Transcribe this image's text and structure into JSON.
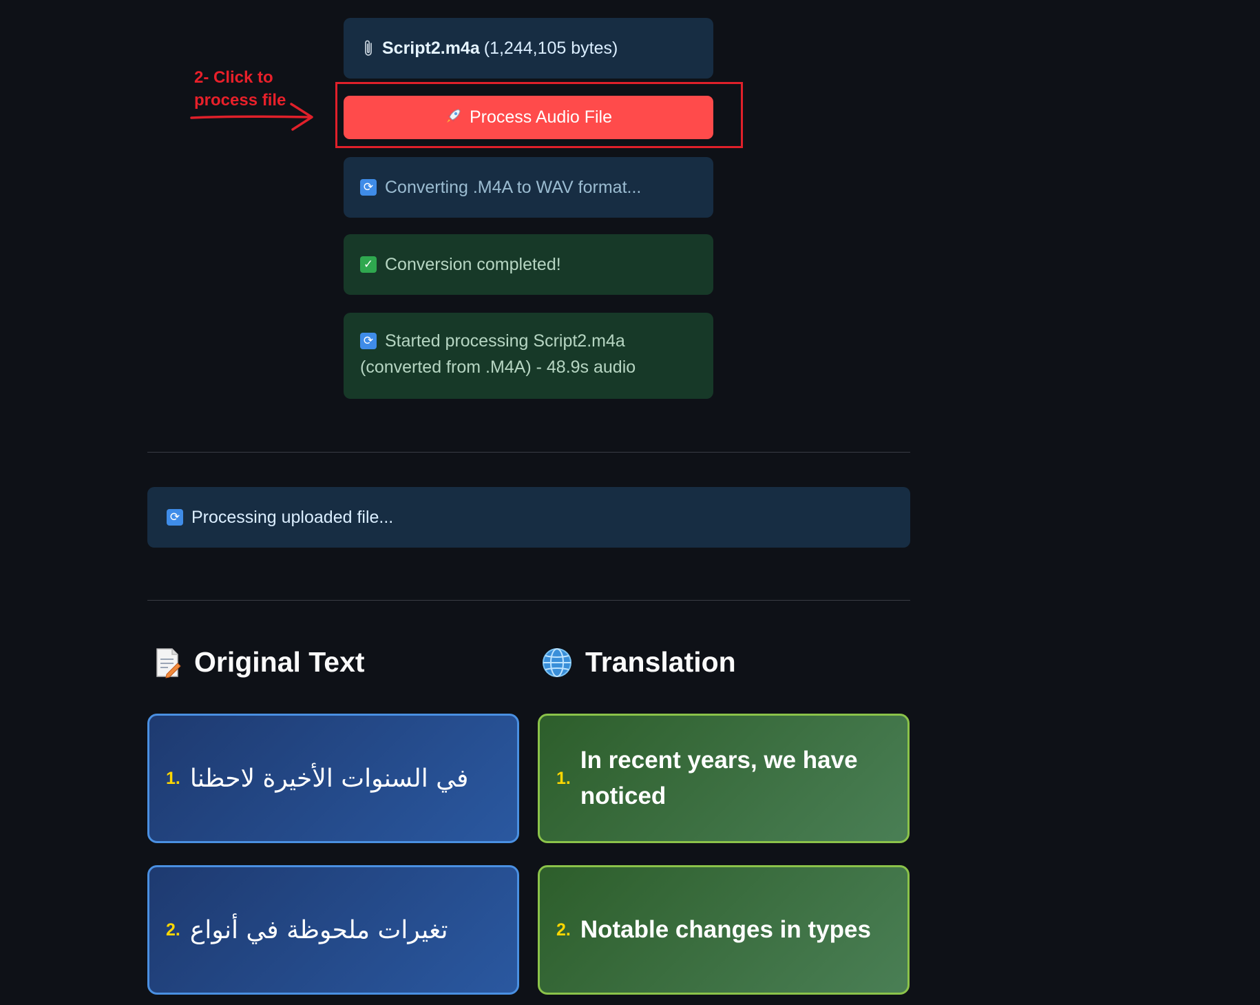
{
  "file": {
    "icon": "paperclip-icon",
    "name": "Script2.m4a",
    "size": "(1,244,105 bytes)"
  },
  "annotation": {
    "text": "2- Click to process file",
    "color": "#e0202a"
  },
  "process_button": {
    "icon": "rocket-icon",
    "label": "Process Audio File",
    "color": "#ff4b4b"
  },
  "status": {
    "converting": "Converting .M4A to WAV format...",
    "completed": "Conversion completed!",
    "started": "Started processing Script2.m4a (converted from .M4A) - 48.9s audio",
    "processing": "Processing uploaded file..."
  },
  "headings": {
    "original": "Original Text",
    "original_icon": "memo-icon",
    "translation": "Translation",
    "translation_icon": "globe-icon"
  },
  "segments": [
    {
      "num": "1.",
      "original": "في السنوات الأخيرة لاحظنا",
      "translation": "In recent years, we have noticed"
    },
    {
      "num": "2.",
      "original": "تغيرات ملحوظة في أنواع",
      "translation": "Notable changes in types"
    }
  ],
  "colors": {
    "background": "#0e1117",
    "info_bg": "#172d43",
    "success_bg": "#173928",
    "original_border": "#4a90e2",
    "translation_border": "#8bc34a",
    "number": "#ffd700"
  }
}
